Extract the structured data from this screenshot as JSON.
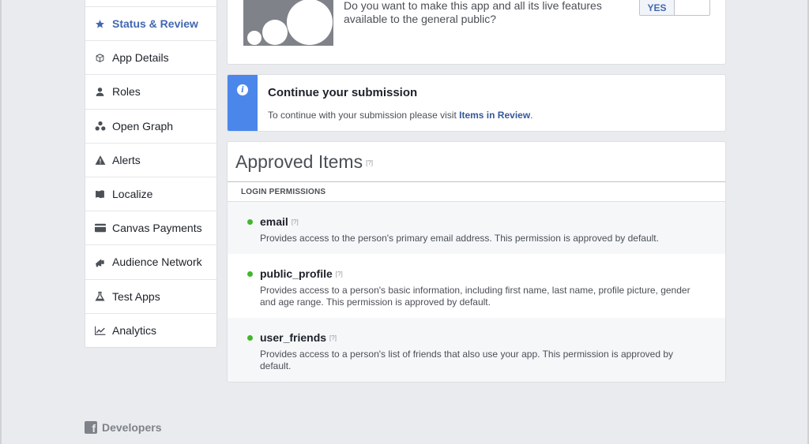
{
  "sidebar": {
    "items": [
      {
        "label": "Status & Review",
        "icon": "star-icon",
        "active": true
      },
      {
        "label": "App Details",
        "icon": "cube-icon"
      },
      {
        "label": "Roles",
        "icon": "person-icon"
      },
      {
        "label": "Open Graph",
        "icon": "graph-nodes-icon"
      },
      {
        "label": "Alerts",
        "icon": "warning-icon"
      },
      {
        "label": "Localize",
        "icon": "flag-icon"
      },
      {
        "label": "Canvas Payments",
        "icon": "card-icon"
      },
      {
        "label": "Audience Network",
        "icon": "megaphone-icon"
      },
      {
        "label": "Test Apps",
        "icon": "flask-icon"
      },
      {
        "label": "Analytics",
        "icon": "chart-icon"
      }
    ]
  },
  "public_card": {
    "question": "Do you want to make this app and all its live features available to the general public?",
    "toggle_yes": "YES"
  },
  "submission": {
    "title": "Continue your submission",
    "text": "To continue with your submission please visit ",
    "link": "Items in Review",
    "text_end": "."
  },
  "approved": {
    "title": "Approved Items",
    "help": "[?]",
    "section": "LOGIN PERMISSIONS",
    "permissions": [
      {
        "name": "email",
        "help": "[?]",
        "description": "Provides access to the person's primary email address. This permission is approved by default."
      },
      {
        "name": "public_profile",
        "help": "[?]",
        "description": "Provides access to a person's basic information, including first name, last name, profile picture, gender and age range. This permission is approved by default."
      },
      {
        "name": "user_friends",
        "help": "[?]",
        "description": "Provides access to a person's list of friends that also use your app. This permission is approved by default."
      }
    ]
  },
  "footer": {
    "logo_letter": "f",
    "label": "Developers"
  },
  "colors": {
    "accent": "#4267b2",
    "info": "#4b87ea",
    "status_green": "#42b72a",
    "page_bg": "#e9ebee"
  }
}
